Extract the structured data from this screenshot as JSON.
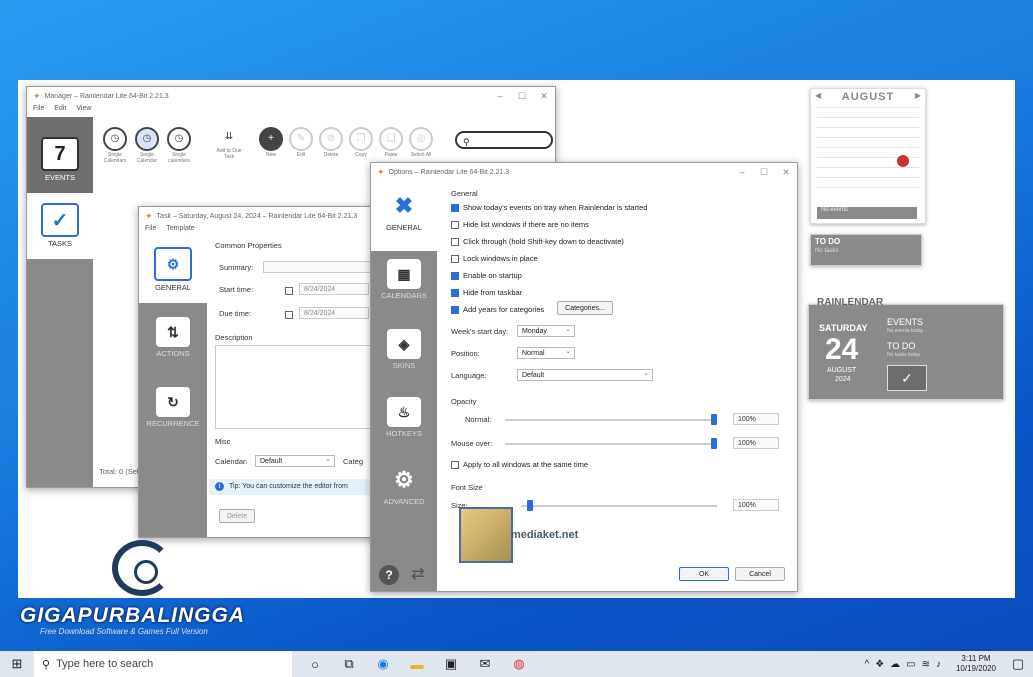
{
  "manager": {
    "title": "Manager – Rainlendar Lite 64-Bit 2.21.3",
    "menu": [
      "File",
      "Edit",
      "View"
    ],
    "nav": [
      {
        "label": "EVENTS",
        "icon": "7"
      },
      {
        "label": "TASKS",
        "icon": "✓"
      }
    ],
    "tools": [
      "Single Calendars",
      "Single Calendar",
      "Single calendars",
      "Add to Due Task",
      "New",
      "Edit",
      "Delete",
      "Copy",
      "Paste",
      "Select All"
    ],
    "status": "Total: 0 (Sel"
  },
  "task": {
    "title": "Task – Saturday, August 24, 2024 – Rainlendar Lite 64-Bit 2.21.3",
    "menu": [
      "File",
      "Template"
    ],
    "nav": [
      "GENERAL",
      "ACTIONS",
      "RECURRENCE"
    ],
    "common_properties": "Common Properties",
    "summary_label": "Summary:",
    "start_label": "Start time:",
    "due_label": "Due time:",
    "start_date": "8/24/2024",
    "due_date": "8/24/2024",
    "description_label": "Description",
    "misc_label": "Misc",
    "calendar_label": "Calendar:",
    "calendar_value": "Default",
    "category_label": "Categ",
    "tip": "Tip: You can customize the editor from",
    "delete": "Delete"
  },
  "options": {
    "title": "Options – Rainlendar Lite 64-Bit 2.21.3",
    "nav": [
      "GENERAL",
      "CALENDARS",
      "SKINS",
      "HOTKEYS",
      "ADVANCED"
    ],
    "section_general": "General",
    "checks": [
      {
        "label": "Show today's events on tray when Rainlendar is started",
        "on": true
      },
      {
        "label": "Hide list windows if there are no items",
        "on": false
      },
      {
        "label": "Click through (hold Shift-key down to deactivate)",
        "on": false
      },
      {
        "label": "Lock windows in place",
        "on": false
      },
      {
        "label": "Enable on startup",
        "on": true
      },
      {
        "label": "Hide from taskbar",
        "on": true
      },
      {
        "label": "Add years for categories",
        "on": true
      }
    ],
    "categories_btn": "Categories...",
    "week_start_label": "Week's start day:",
    "week_start": "Monday",
    "position_label": "Position:",
    "position": "Normal",
    "language_label": "Language:",
    "language": "Default",
    "opacity_label": "Opacity",
    "normal_label": "Normal:",
    "normal_value": "100%",
    "mouse_over_label": "Mouse over:",
    "mouse_over_value": "100%",
    "apply_all": "Apply to all windows at the same time",
    "font_size_label": "Font Size",
    "size_label": "Size:",
    "size_value": "100%",
    "ok": "OK",
    "cancel": "Cancel",
    "watermark": "mediaket.net"
  },
  "calendar_widget": {
    "month": "AUGUST",
    "footer": "No events"
  },
  "todo_widget": {
    "title": "TO DO",
    "sub": "No tasks"
  },
  "rainlendar_widget": {
    "title": "RAINLENDAR",
    "day": "SATURDAY",
    "date": "24",
    "month": "AUGUST",
    "year": "2024",
    "events": "EVENTS",
    "events_sub": "No events today",
    "todo": "TO DO",
    "todo_sub": "No tasks today"
  },
  "brand": {
    "name": "GIGAPURBALINGGA",
    "tagline": "Free Download Software & Games Full Version"
  },
  "taskbar": {
    "search_placeholder": "Type here to search",
    "time": "3:11 PM",
    "date": "10/19/2020"
  }
}
